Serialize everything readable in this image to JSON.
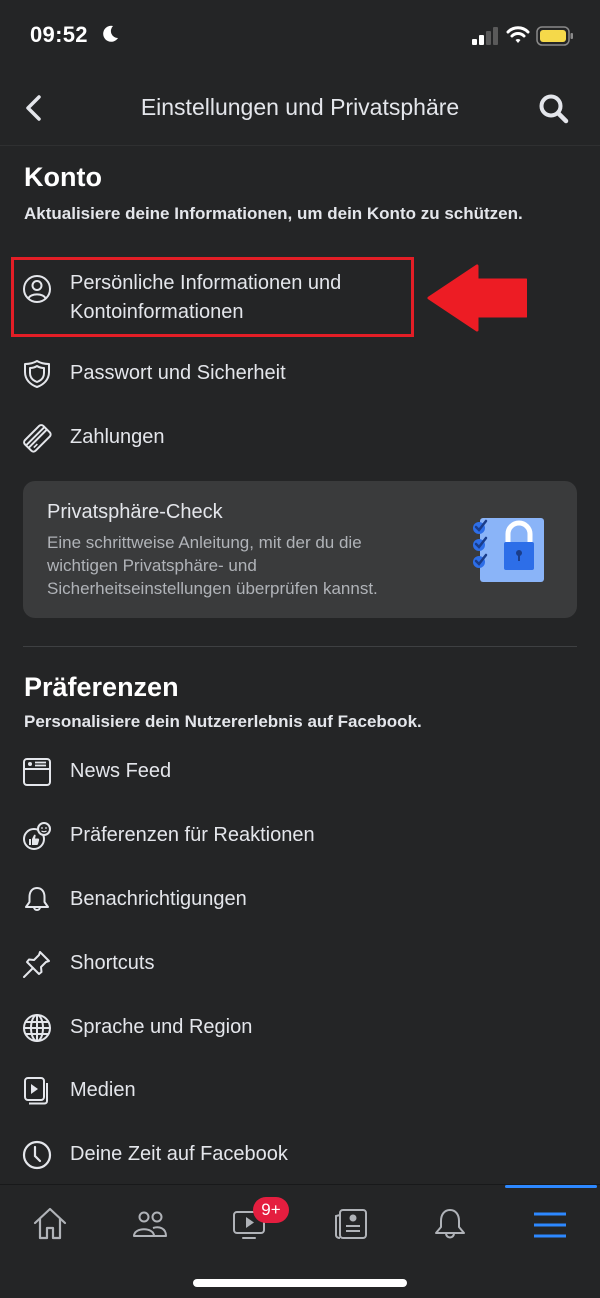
{
  "status_bar": {
    "time": "09:52",
    "focus_mode": "moon-icon",
    "signal_bars": 2,
    "wifi": "wifi-icon",
    "battery_color": "#f5d94a"
  },
  "nav": {
    "title": "Einstellungen und Privatsphäre",
    "back_icon": "chevron-left-icon",
    "search_icon": "search-icon"
  },
  "konto": {
    "title": "Konto",
    "subtitle": "Aktualisiere deine Informationen, um dein Konto zu schützen.",
    "items": [
      {
        "label": "Persönliche Informationen und Kontoinformationen",
        "line1": "Persönliche Informationen und",
        "line2": "Kontoinformationen",
        "icon": "user-circle-icon",
        "highlighted": true
      },
      {
        "label": "Passwort und Sicherheit",
        "icon": "shield-icon"
      },
      {
        "label": "Zahlungen",
        "icon": "credit-card-icon"
      }
    ]
  },
  "privacy_check": {
    "title": "Privatsphäre-Check",
    "description": "Eine schrittweise Anleitung, mit der du die wichtigen Privatsphäre- und Sicherheitseinstellungen überprüfen kannst.",
    "illustration": "checklist-lock-icon"
  },
  "annotation": {
    "box_color": "#e31e26",
    "arrow_color": "#ed1c24"
  },
  "praeferenzen": {
    "title": "Präferenzen",
    "subtitle": "Personalisiere dein Nutzererlebnis auf Facebook.",
    "items": [
      {
        "label": "News Feed",
        "icon": "news-feed-icon"
      },
      {
        "label": "Präferenzen für Reaktionen",
        "icon": "reactions-icon"
      },
      {
        "label": "Benachrichtigungen",
        "icon": "bell-icon"
      },
      {
        "label": "Shortcuts",
        "icon": "pin-icon"
      },
      {
        "label": "Sprache und Region",
        "icon": "globe-icon"
      },
      {
        "label": "Medien",
        "icon": "media-icon"
      },
      {
        "label": "Deine Zeit auf Facebook",
        "icon": "clock-icon"
      }
    ]
  },
  "tab_bar": {
    "tabs": [
      {
        "name": "home",
        "icon": "home-icon"
      },
      {
        "name": "friends",
        "icon": "friends-icon"
      },
      {
        "name": "watch",
        "icon": "watch-icon",
        "badge": "9+"
      },
      {
        "name": "news",
        "icon": "news-icon"
      },
      {
        "name": "notifications",
        "icon": "bell-icon"
      },
      {
        "name": "menu",
        "icon": "hamburger-menu-icon",
        "active": true
      }
    ],
    "accent_color": "#2d88ff",
    "badge_color": "#e41e3f"
  }
}
